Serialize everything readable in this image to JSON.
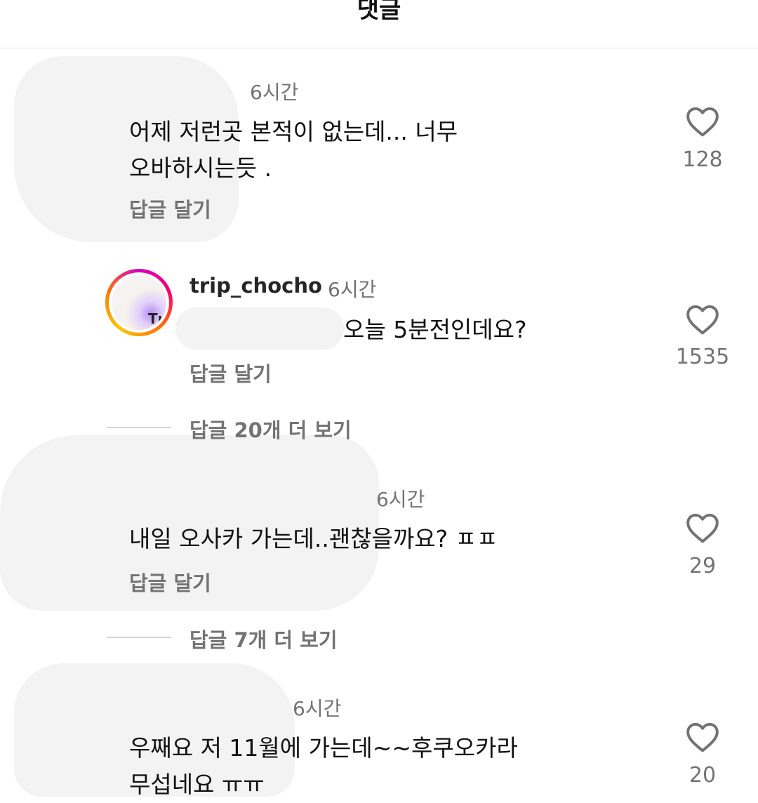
{
  "header": {
    "title": "댓글"
  },
  "comments": [
    {
      "time": "6시간",
      "text_lines": [
        "어제 저런곳 본적이 없는데... 너무",
        "오바하시는듯 ."
      ],
      "reply_label": "답글 달기",
      "likes": "128"
    },
    {
      "username": "trip_chocho",
      "avatar_letter": "Tı",
      "time": "6시간",
      "text_lines": [
        "오늘 5분전인데요?"
      ],
      "reply_label": "답글 달기",
      "likes": "1535",
      "more_replies": "답글 20개 더 보기"
    },
    {
      "time": "6시간",
      "text_lines": [
        "내일 오사카 가는데..괜찮을까요? ㅍㅍ"
      ],
      "reply_label": "답글 달기",
      "likes": "29",
      "more_replies": "답글 7개 더 보기"
    },
    {
      "time": "6시간",
      "text_lines": [
        "우째요 저 11월에 가는데~~후쿠오카라",
        "무섭네요 ㅠㅠ"
      ],
      "likes": "20"
    }
  ],
  "icons": {
    "like": "heart-outline-icon"
  },
  "colors": {
    "secondary_text": "#737373",
    "primary_text": "#111111",
    "divider": "#e6e6e6"
  }
}
